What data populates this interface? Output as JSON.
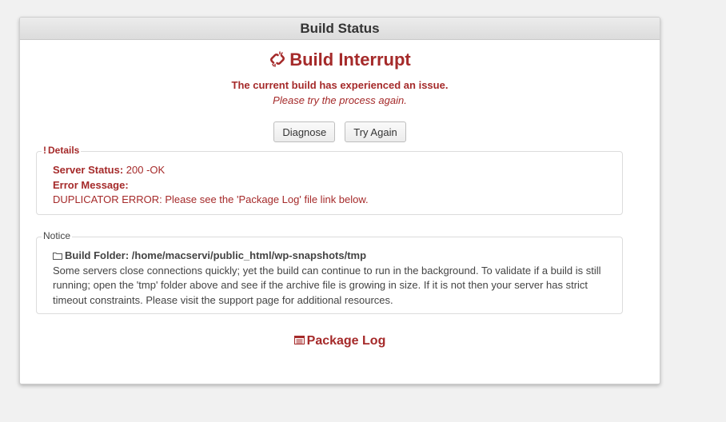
{
  "header": {
    "title": "Build Status"
  },
  "status": {
    "title": "Build Interrupt",
    "message": "The current build has experienced an issue.",
    "sub_message": "Please try the process again."
  },
  "buttons": {
    "diagnose": "Diagnose",
    "try_again": "Try Again"
  },
  "details": {
    "legend_mark": "!",
    "legend": "Details",
    "server_status_label": "Server Status:",
    "server_status_value": " 200 -OK",
    "error_label": "Error Message:",
    "error_text": "DUPLICATOR ERROR: Please see the 'Package Log' file link below."
  },
  "notice": {
    "legend": "Notice",
    "folder": "Build Folder: /home/macservi/public_html/wp-snapshots/tmp",
    "text": "Some servers close connections quickly; yet the build can continue to run in the background. To validate if a build is still running; open the 'tmp' folder above and see if the archive file is growing in size. If it is not then your server has strict timeout constraints. Please visit the support page for additional resources."
  },
  "package_log": {
    "label": "Package Log"
  },
  "colors": {
    "accent": "#a52a2a",
    "text": "#444444",
    "background": "#f1f1f1"
  },
  "icons": {
    "title": "broken-link-icon",
    "folder": "folder-icon",
    "log": "log-list-icon"
  }
}
